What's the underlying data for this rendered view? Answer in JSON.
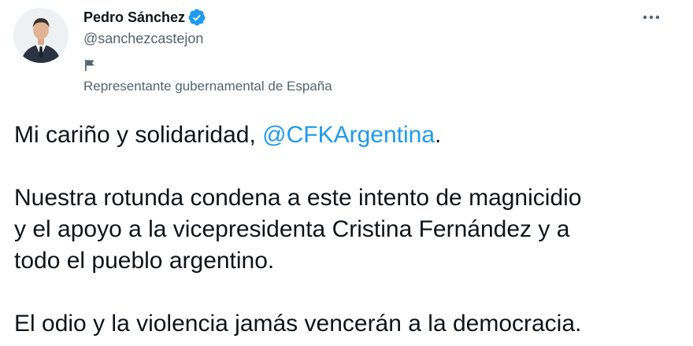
{
  "author": {
    "name": "Pedro Sánchez",
    "handle": "@sanchezcastejon",
    "label": "Representante gubernamental de España"
  },
  "icons": {
    "avatar": "profile-photo",
    "verified": "verified-badge-icon",
    "label": "flag-icon",
    "more": "more-options-icon"
  },
  "colors": {
    "accent": "#1d9bf0",
    "text": "#0f1419",
    "secondary": "#536471"
  },
  "tweet": {
    "line1_prefix": "Mi cariño y solidaridad, ",
    "mention": "@CFKArgentina",
    "line1_suffix": ".",
    "paragraph2_line1": "Nuestra rotunda condena a este intento de magnicidio",
    "paragraph2_line2": "y el apoyo a la vicepresidenta Cristina Fernández y a",
    "paragraph2_line3": "todo el pueblo argentino.",
    "paragraph3": "El odio y la violencia jamás vencerán a la democracia."
  }
}
